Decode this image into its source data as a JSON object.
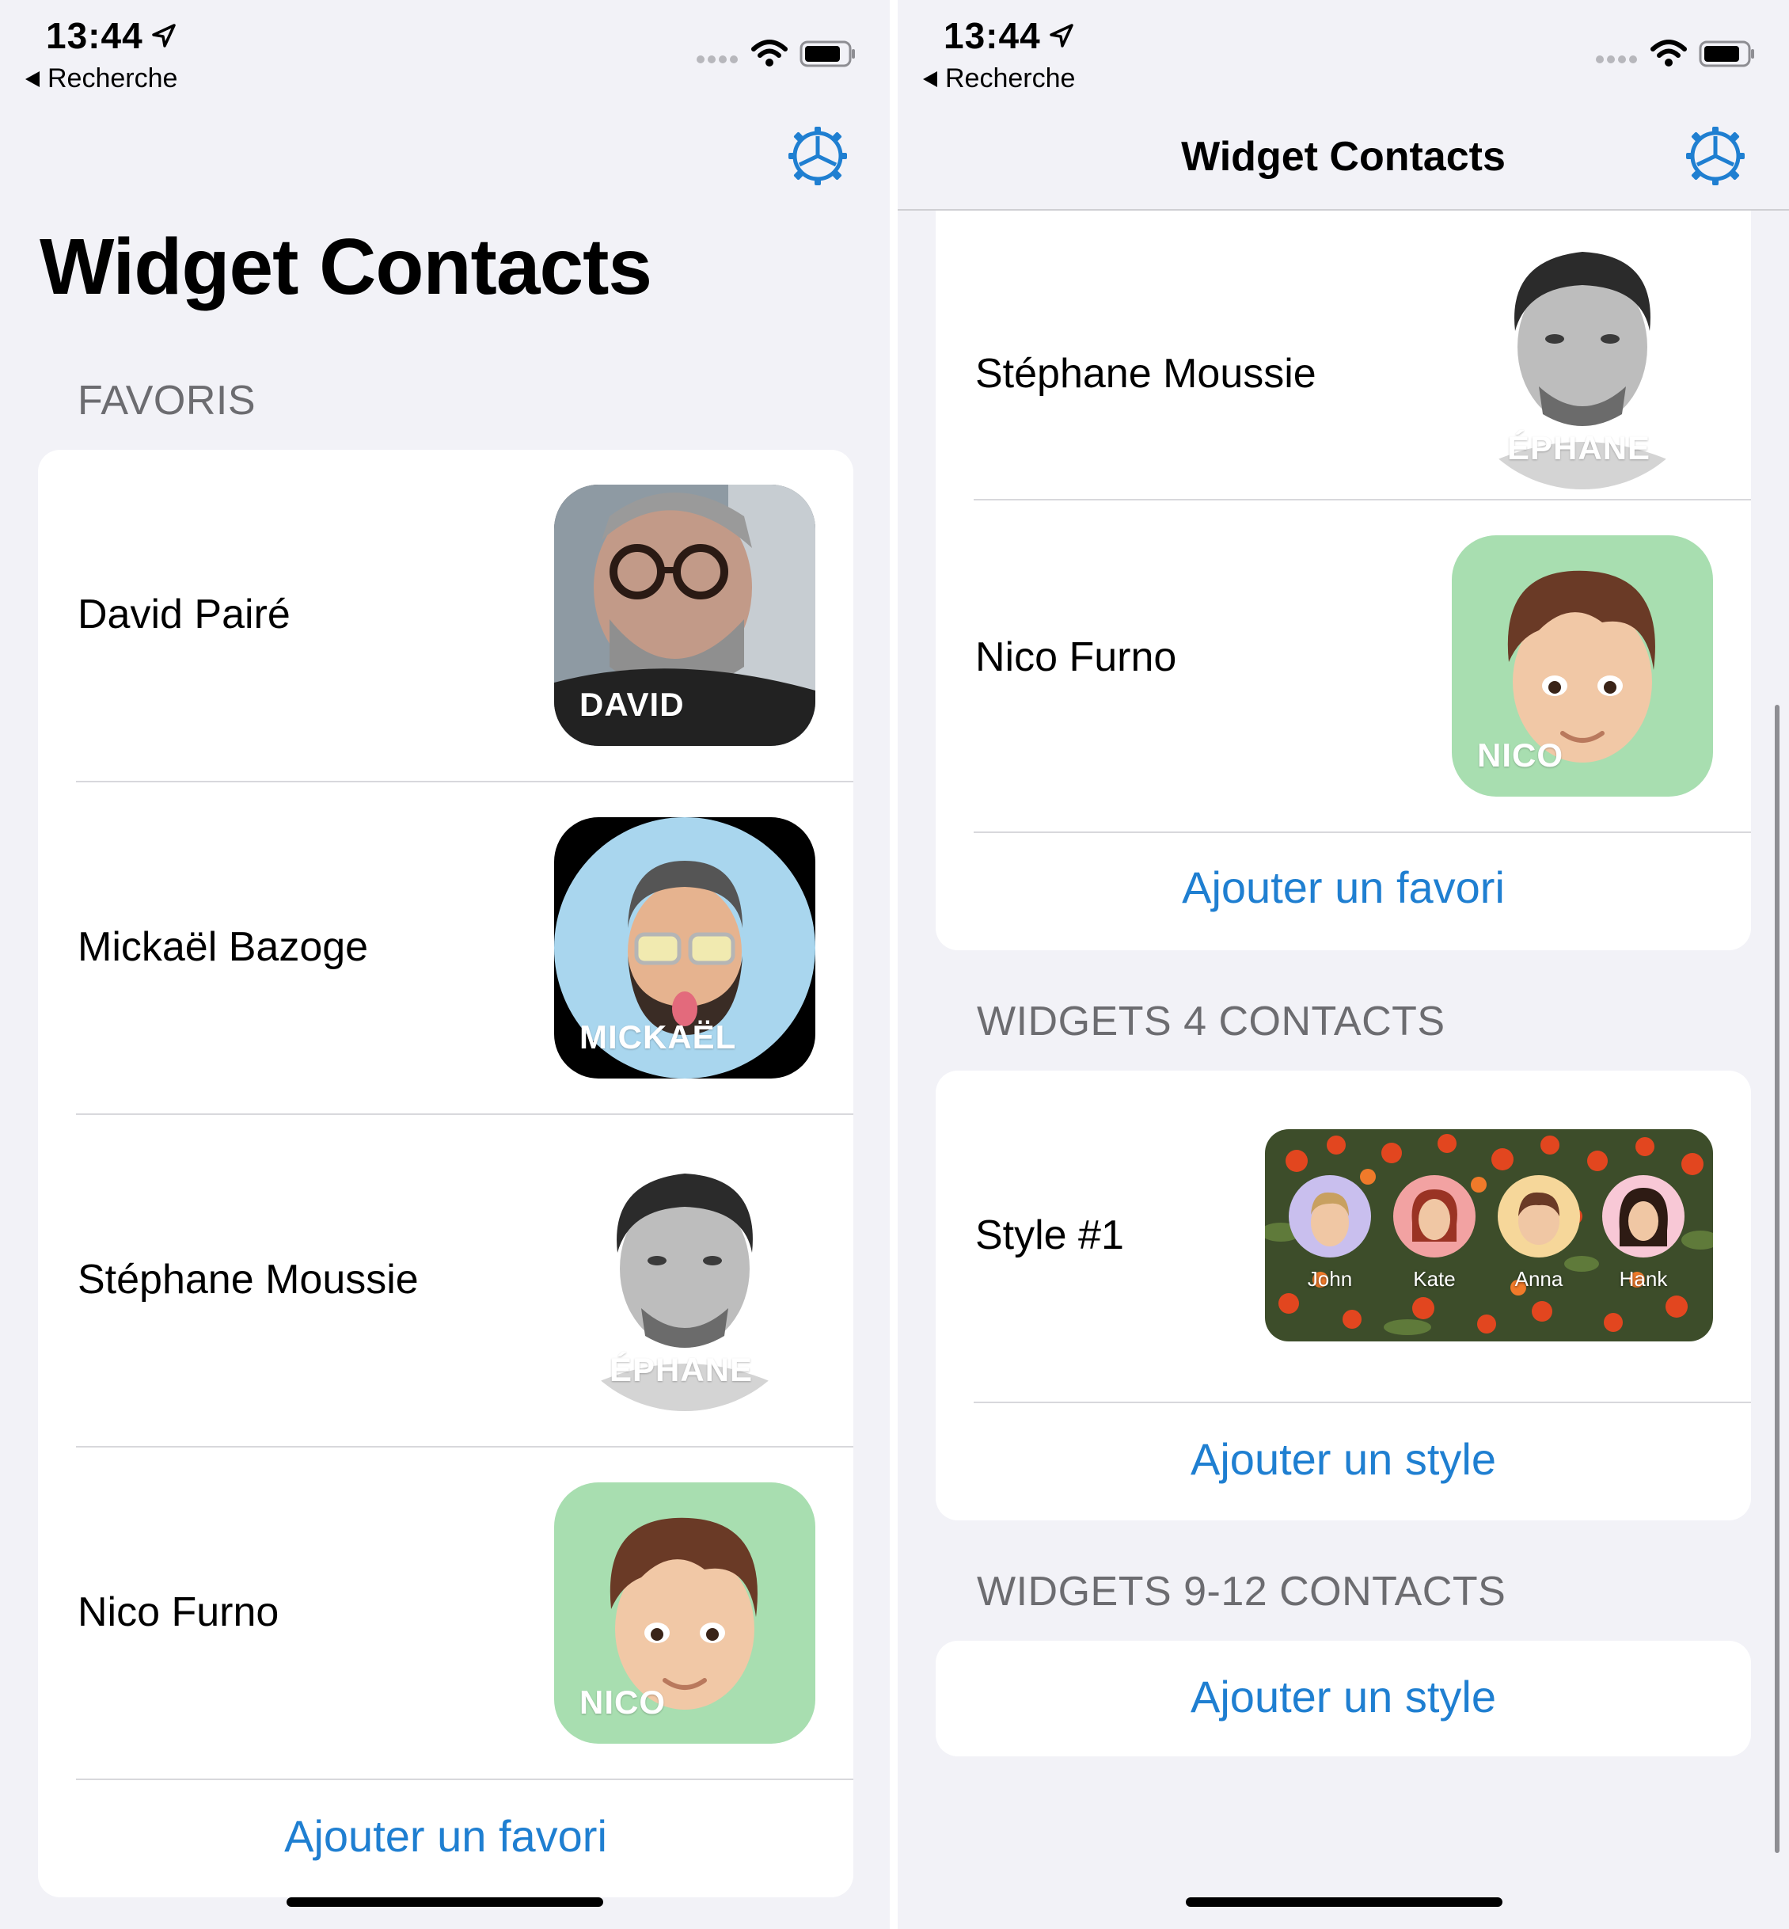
{
  "status": {
    "time": "13:44",
    "back": "Recherche"
  },
  "app": {
    "title": "Widget Contacts"
  },
  "icons": {
    "settings": "gear-icon",
    "location": "location-arrow-icon",
    "wifi": "wifi-icon",
    "battery": "battery-icon",
    "back": "back-triangle-icon"
  },
  "colors": {
    "accent": "#1f7fd1",
    "background": "#f2f2f7",
    "card": "#ffffff",
    "section": "#6c6c70",
    "nico_bg": "#a8deb0",
    "mickael_bg": "#a9d6ee"
  },
  "left": {
    "section_favoris": "FAVORIS",
    "favorites": [
      {
        "name": "David Pairé",
        "badge": "DAVID"
      },
      {
        "name": "Mickaël Bazoge",
        "badge": "MICKAËL"
      },
      {
        "name": "Stéphane Moussie",
        "badge": "ÉPHANE"
      },
      {
        "name": "Nico Furno",
        "badge": "NICO"
      }
    ],
    "add_favorite": "Ajouter un favori"
  },
  "right": {
    "favorites": [
      {
        "name": "Stéphane Moussie",
        "badge": "ÉPHANE"
      },
      {
        "name": "Nico Furno",
        "badge": "NICO"
      }
    ],
    "add_favorite": "Ajouter un favori",
    "section_4": "WIDGETS 4 CONTACTS",
    "style_label": "Style #1",
    "style_contacts": [
      "John",
      "Kate",
      "Anna",
      "Hank"
    ],
    "add_style": "Ajouter un style",
    "section_9_12": "WIDGETS 9-12 CONTACTS",
    "add_style_2": "Ajouter un style"
  }
}
